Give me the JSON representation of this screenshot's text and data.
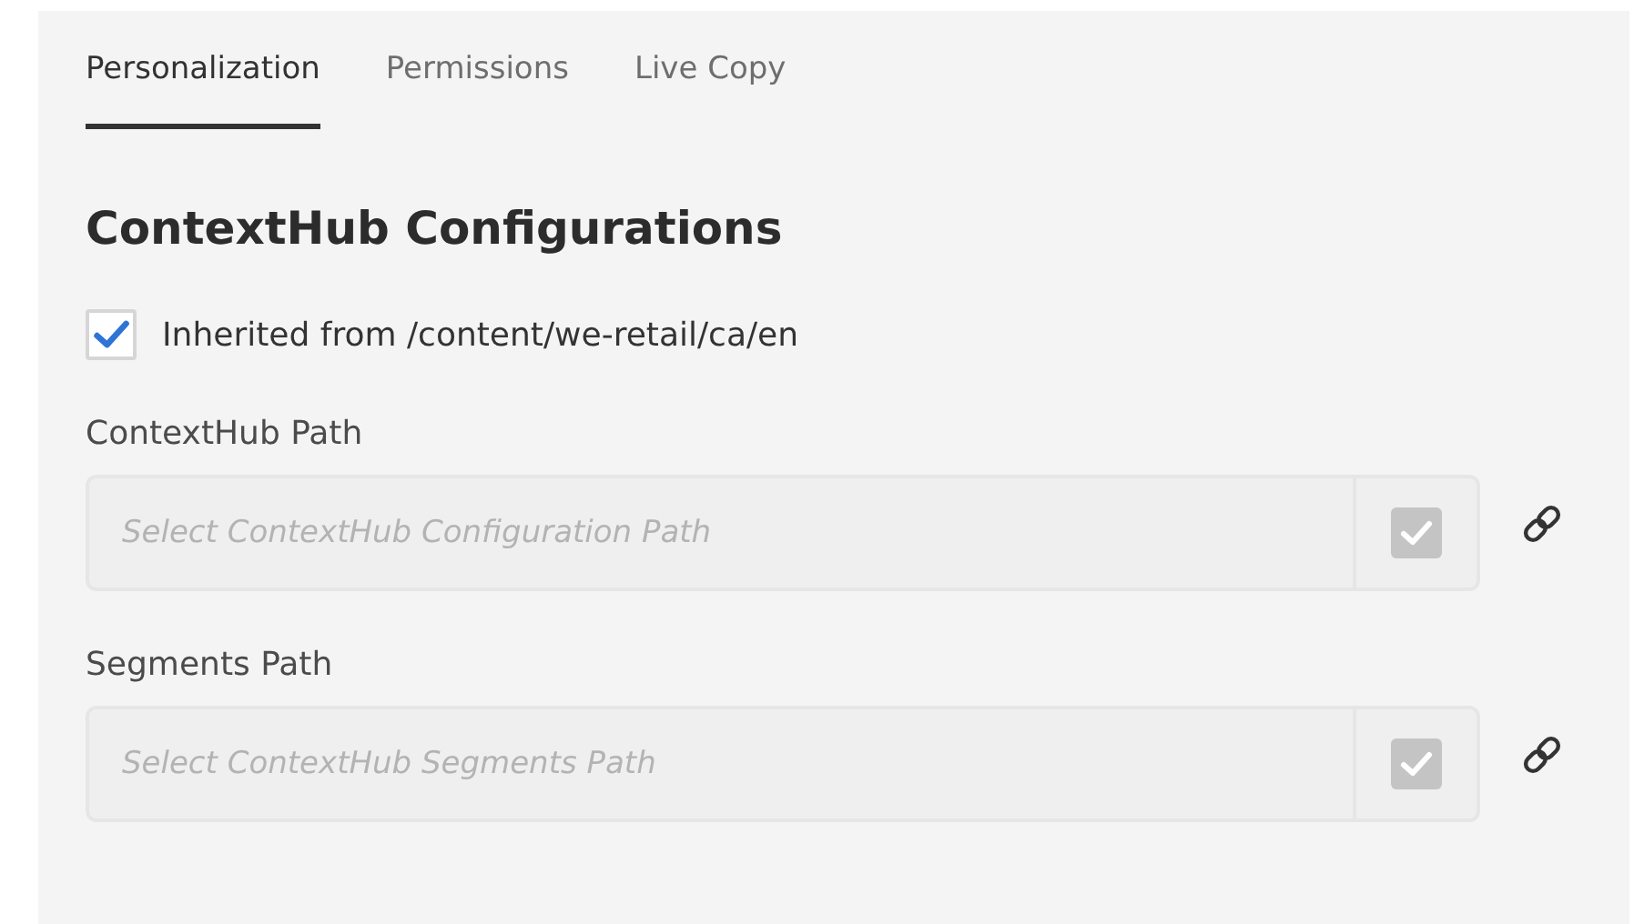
{
  "tabs": [
    {
      "label": "Personalization",
      "selected": true
    },
    {
      "label": "Permissions",
      "selected": false
    },
    {
      "label": "Live Copy",
      "selected": false
    }
  ],
  "section": {
    "title": "ContextHub Configurations"
  },
  "inherit": {
    "label": "Inherited from /content/we-retail/ca/en",
    "checked": true
  },
  "fields": [
    {
      "label": "ContextHub Path",
      "placeholder": "Select ContextHub Configuration Path",
      "disabled": true
    },
    {
      "label": "Segments Path",
      "placeholder": "Select ContextHub Segments Path",
      "disabled": true
    }
  ]
}
